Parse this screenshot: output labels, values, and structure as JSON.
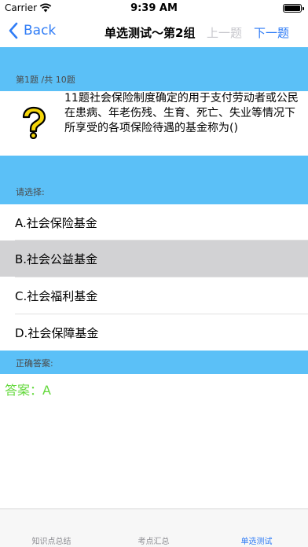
{
  "status": {
    "carrier": "Carrier",
    "time": "9:39 AM"
  },
  "nav": {
    "back_label": "Back",
    "title": "单选测试～第2组",
    "prev_label": "上一题",
    "next_label": "下一题"
  },
  "question": {
    "index_text": "第1题 /共 10题",
    "icon": "question-mark-icon",
    "text": "11题社会保险制度确定的用于支付劳动者或公民在患病、年老伤残、生育、死亡、失业等情况下所享受的各项保险待遇的基金称为()"
  },
  "choose_label": "请选择:",
  "options": [
    {
      "label": "A.社会保险基金",
      "selected": false
    },
    {
      "label": "B.社会公益基金",
      "selected": true
    },
    {
      "label": "C.社会福利基金",
      "selected": false
    },
    {
      "label": "D.社会保障基金",
      "selected": false
    }
  ],
  "answer": {
    "label": "正确答案:",
    "text": "答案：A"
  },
  "tabs": [
    {
      "label": "知识点总结",
      "active": false
    },
    {
      "label": "考点汇总",
      "active": false
    },
    {
      "label": "单选测试",
      "active": true
    }
  ],
  "colors": {
    "accent": "#2f7cf6",
    "band": "#5bc0f7",
    "answer": "#63d83b",
    "selected_row": "#d2d2d4",
    "icon_fill": "#f5d60a"
  }
}
